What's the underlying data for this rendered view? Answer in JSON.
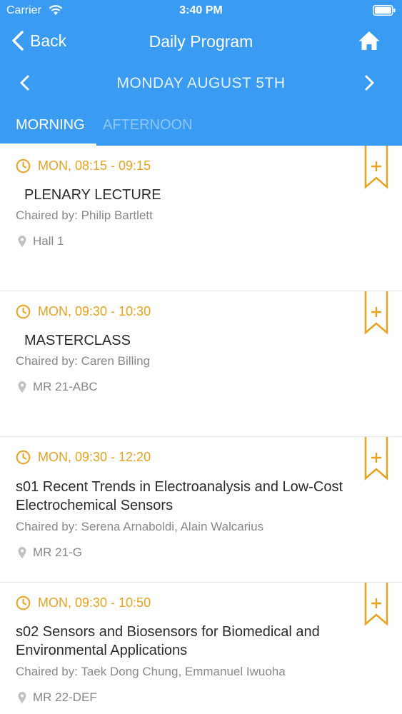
{
  "status": {
    "carrier": "Carrier",
    "time": "3:40 PM"
  },
  "nav": {
    "back_label": "Back",
    "title": "Daily Program"
  },
  "day": {
    "label": "MONDAY AUGUST 5TH"
  },
  "tabs": {
    "morning": "MORNING",
    "afternoon": "AFTERNOON",
    "active": "MORNING"
  },
  "colors": {
    "header": "#3a9bf3",
    "accent": "#e8a21d",
    "muted": "#888888"
  },
  "icons": [
    "wifi-icon",
    "battery-icon",
    "back-chevron-icon",
    "home-icon",
    "chevron-left-icon",
    "chevron-right-icon",
    "clock-icon",
    "location-pin-icon",
    "bookmark-plus-icon"
  ],
  "sessions": [
    {
      "time": "MON, 08:15 - 09:15",
      "title": "PLENARY LECTURE",
      "chair": "Chaired by: Philip Bartlett",
      "location": "Hall 1"
    },
    {
      "time": "MON, 09:30 - 10:30",
      "title": "MASTERCLASS",
      "chair": "Chaired by: Caren Billing",
      "location": "MR 21-ABC"
    },
    {
      "time": "MON, 09:30 - 12:20",
      "title": "s01 Recent Trends in Electroanalysis and Low-Cost Electrochemical Sensors",
      "chair": "Chaired by: Serena Arnaboldi, Alain Walcarius",
      "location": "MR 21-G"
    },
    {
      "time": "MON, 09:30 - 10:50",
      "title": "s02 Sensors and Biosensors for Biomedical and Environmental Applications",
      "chair": "Chaired by: Taek Dong Chung, Emmanuel Iwuoha",
      "location": "MR 22-DEF"
    }
  ]
}
